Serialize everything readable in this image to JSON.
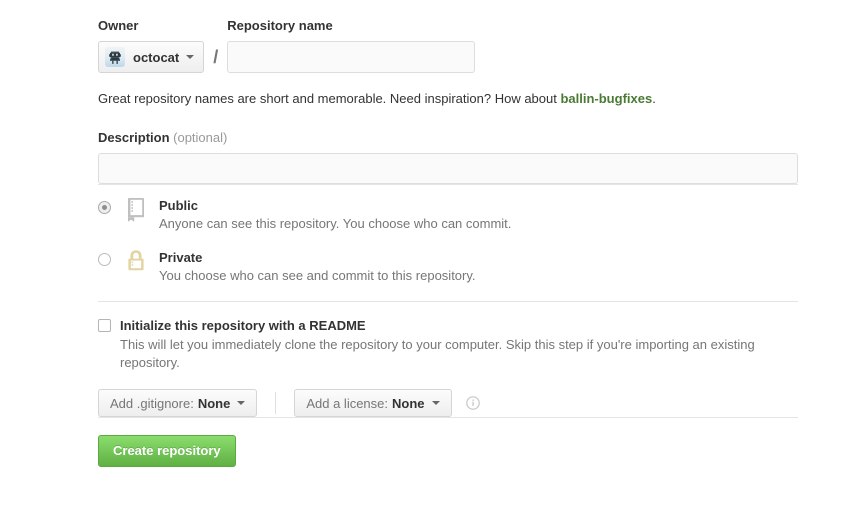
{
  "form": {
    "owner": {
      "label": "Owner",
      "name": "octocat",
      "avatar_icon": "octocat-avatar-icon",
      "caret_icon": "chevron-down-icon"
    },
    "repository_name": {
      "label": "Repository name",
      "value": "",
      "placeholder": ""
    },
    "separator": "/",
    "hint": {
      "before": "Great repository names are short and memorable. Need inspiration? How about ",
      "suggestion": "ballin-bugfixes",
      "after": "."
    },
    "description": {
      "label": "Description",
      "optional_label": "(optional)",
      "value": "",
      "placeholder": ""
    },
    "visibility": {
      "options": [
        {
          "id": "public",
          "title": "Public",
          "description": "Anyone can see this repository. You choose who can commit.",
          "icon": "repo-book-icon",
          "icon_color": "#bfbfbf",
          "selected": true
        },
        {
          "id": "private",
          "title": "Private",
          "description": "You choose who can see and commit to this repository.",
          "icon": "lock-icon",
          "icon_color": "#e3d4a4",
          "selected": false
        }
      ]
    },
    "readme": {
      "label": "Initialize this repository with a README",
      "description": "This will let you immediately clone the repository to your computer. Skip this step if you're importing an existing repository.",
      "checked": false
    },
    "gitignore": {
      "prefix": "Add .gitignore:",
      "value": "None",
      "caret_icon": "chevron-down-icon"
    },
    "license": {
      "prefix": "Add a license:",
      "value": "None",
      "caret_icon": "chevron-down-icon",
      "info_icon": "info-circle-icon"
    },
    "submit": {
      "label": "Create repository"
    }
  },
  "colors": {
    "accent_green": "#6cc644",
    "suggestion_green": "#4a7a34",
    "muted_text": "#767676",
    "border": "#dddddd",
    "rule": "#e5e5e5",
    "lock_tan": "#e3d4a4",
    "repo_gray": "#bfbfbf"
  }
}
